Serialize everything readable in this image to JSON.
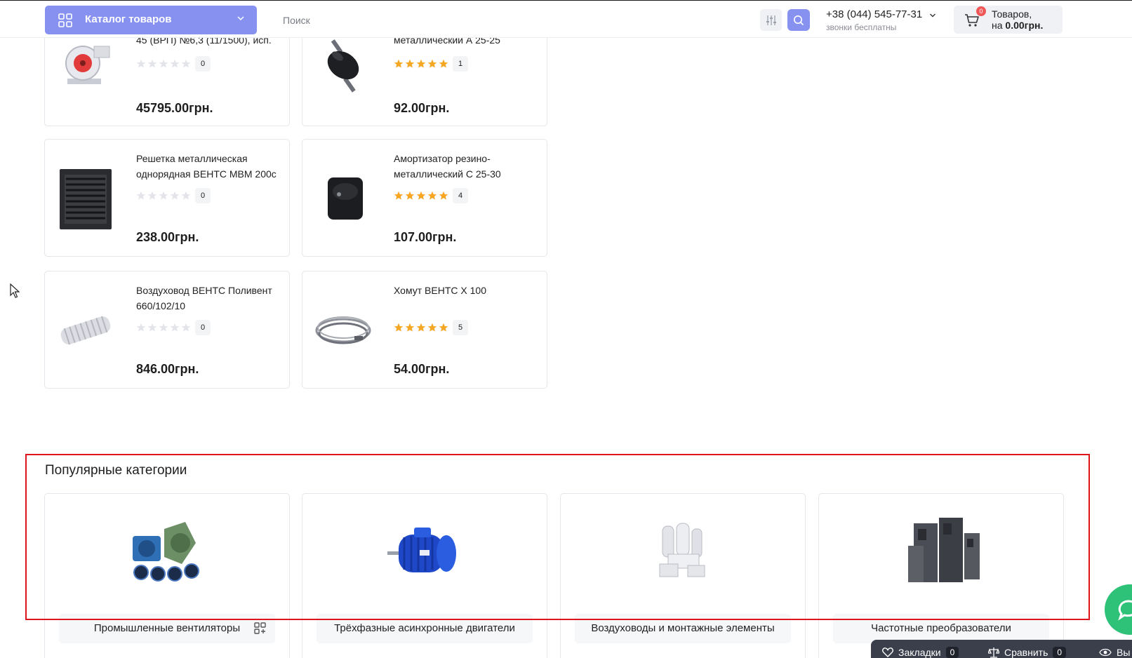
{
  "header": {
    "catalog_label": "Каталог товаров",
    "search_placeholder": "Поиск",
    "phone": "+38 (044) 545-77-31",
    "phone_note": "звонки бесплатны",
    "cart": {
      "badge": "0",
      "line1": "Товаров,",
      "line2_prefix": "на ",
      "line2_amount": "0.00грн."
    }
  },
  "products": [
    {
      "title": "45 (ВРП) №6,3 (11/1500), исп.",
      "rating_count": "0",
      "stars_filled": 0,
      "price": "45795.00грн."
    },
    {
      "title": "металлический А 25-25",
      "rating_count": "1",
      "stars_filled": 5,
      "price": "92.00грн."
    },
    {
      "title": "Решетка металлическая однорядная ВЕНТС МВМ 200с",
      "rating_count": "0",
      "stars_filled": 0,
      "price": "238.00грн."
    },
    {
      "title": "Амортизатор резино-металлический С 25-30",
      "rating_count": "4",
      "stars_filled": 5,
      "price": "107.00грн."
    },
    {
      "title": "Воздуховод ВЕНТС Поливент 660/102/10",
      "rating_count": "0",
      "stars_filled": 0,
      "price": "846.00грн."
    },
    {
      "title": "Хомут ВЕНТС Х 100",
      "rating_count": "5",
      "stars_filled": 5,
      "price": "54.00грн."
    }
  ],
  "popular": {
    "title": "Популярные категории",
    "categories": [
      {
        "label": "Промышленные вентиляторы",
        "icon": "fans-image"
      },
      {
        "label": "Трёхфазные асинхронные двигатели",
        "icon": "motor-image"
      },
      {
        "label": "Воздуховоды и монтажные элементы",
        "icon": "ducts-image"
      },
      {
        "label": "Частотные преобразователи",
        "icon": "inverters-image"
      }
    ]
  },
  "bottom_bar": {
    "bookmarks_label": "Закладки",
    "bookmarks_count": "0",
    "compare_label": "Сравнить",
    "compare_count": "0",
    "viewed_label": "Вы"
  },
  "colors": {
    "accent": "#8691f0",
    "star": "#f5a623",
    "highlight": "#e0141d",
    "chat": "#2ec178"
  }
}
